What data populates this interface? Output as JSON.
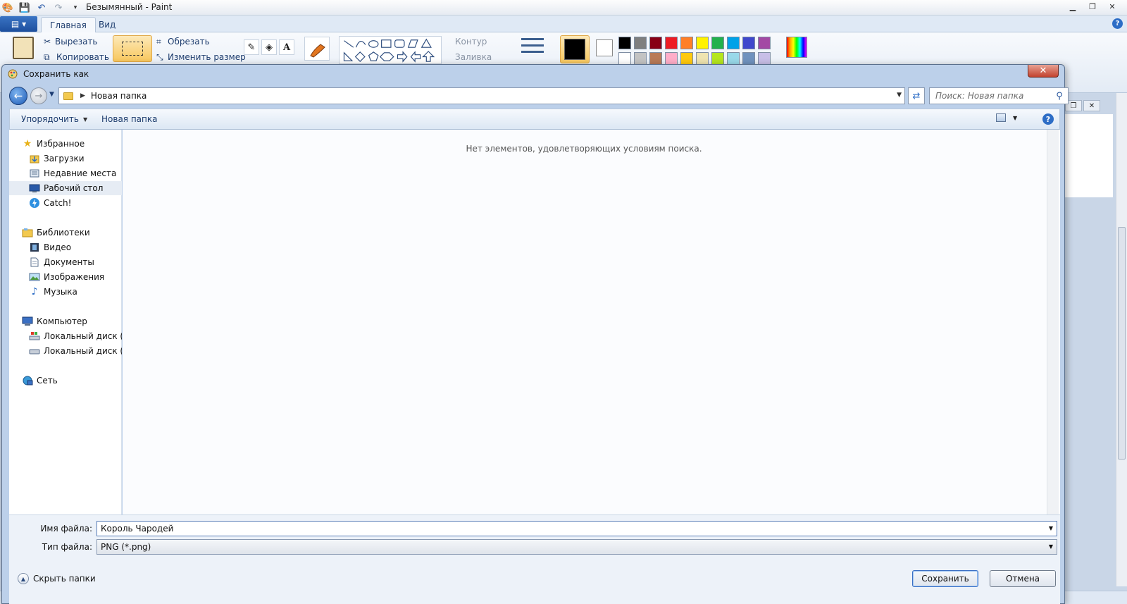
{
  "paint": {
    "title": "Безымянный - Paint",
    "app_menu_label": "▾",
    "tabs": [
      {
        "label": "Главная",
        "active": true
      },
      {
        "label": "Вид",
        "active": false
      }
    ],
    "clipboard": {
      "cut": "Вырезать",
      "copy": "Копировать"
    },
    "image": {
      "crop": "Обрезать",
      "resize": "Изменить размер"
    },
    "shape_options": {
      "outline": "Контур",
      "fill": "Заливка"
    },
    "palette": [
      "#000000",
      "#7f7f7f",
      "#880015",
      "#ed1c24",
      "#ff7f27",
      "#fff200",
      "#22b14c",
      "#00a2e8",
      "#3f48cc",
      "#a349a4",
      "#ffffff",
      "#c3c3c3",
      "#b97a57",
      "#ffaec9",
      "#ffc90e",
      "#efe4b0",
      "#b5e61d",
      "#99d9ea",
      "#7092be",
      "#c8bfe7"
    ],
    "color1": "#000000",
    "color2": "#ffffff"
  },
  "dialog": {
    "title": "Сохранить как",
    "close_label": "✕",
    "address": {
      "crumb": "Новая папка"
    },
    "search": {
      "placeholder": "Поиск: Новая папка"
    },
    "toolbar": {
      "organize": "Упорядочить",
      "new_folder": "Новая папка"
    },
    "nav": {
      "favorites": {
        "header": "Избранное",
        "items": [
          "Загрузки",
          "Недавние места",
          "Рабочий стол",
          "Catch!"
        ]
      },
      "libraries": {
        "header": "Библиотеки",
        "items": [
          "Видео",
          "Документы",
          "Изображения",
          "Музыка"
        ]
      },
      "computer": {
        "header": "Компьютер",
        "items": [
          "Локальный диск (C:",
          "Локальный диск (D:"
        ]
      },
      "network": {
        "header": "Сеть"
      },
      "selected": "Рабочий стол"
    },
    "empty_message": "Нет элементов, удовлетворяющих условиям поиска.",
    "filename": {
      "label": "Имя файла:",
      "value": "Король Чародей"
    },
    "filetype": {
      "label": "Тип файла:",
      "value": "PNG (*.png)"
    },
    "hide_folders": "Скрыть папки",
    "save_button": "Сохранить",
    "cancel_button": "Отмена"
  }
}
